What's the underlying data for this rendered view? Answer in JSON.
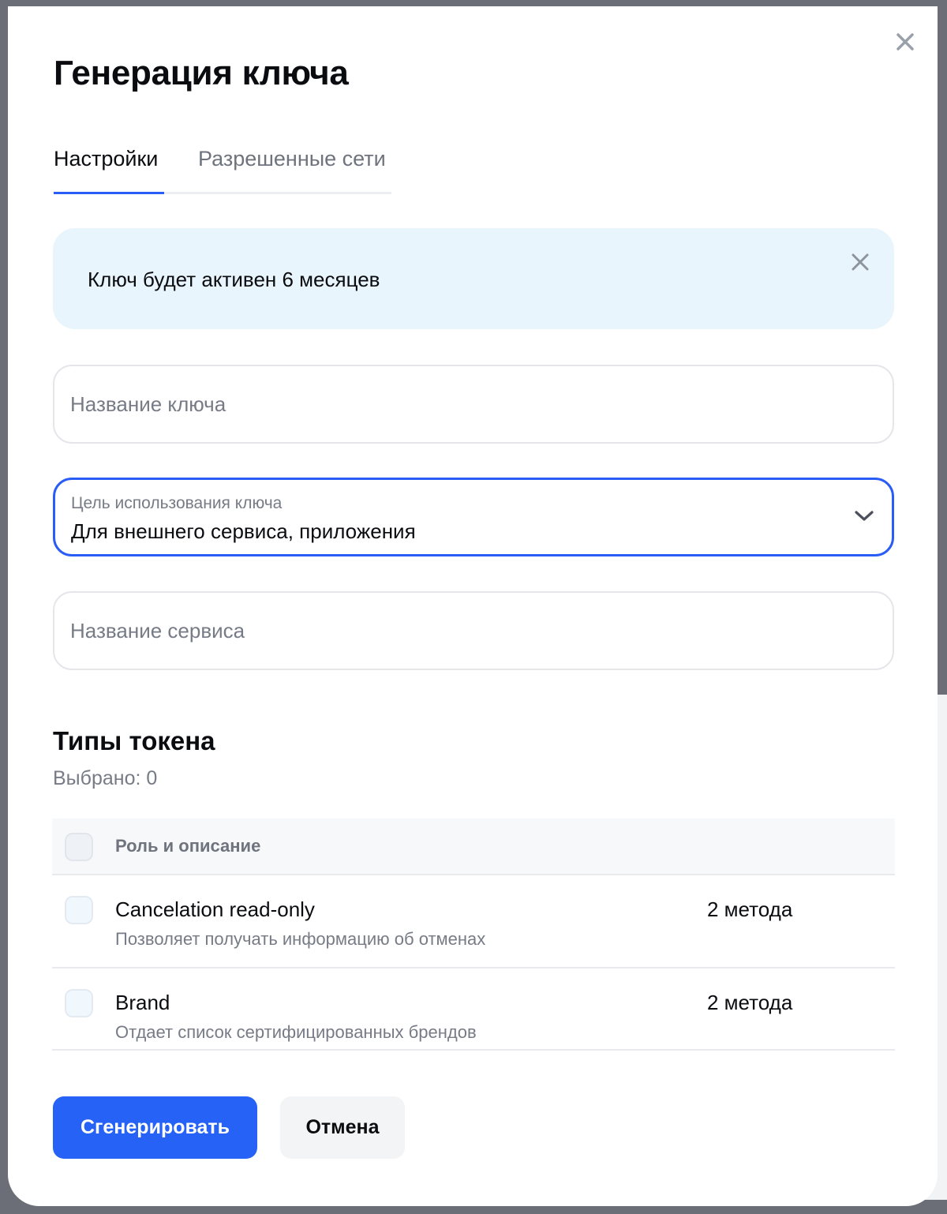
{
  "dialog": {
    "title": "Генерация ключа"
  },
  "tabs": [
    {
      "label": "Настройки",
      "active": true
    },
    {
      "label": "Разрешенные сети",
      "active": false
    }
  ],
  "notice": {
    "text": "Ключ будет активен 6 месяцев"
  },
  "form": {
    "key_name": {
      "value": "",
      "placeholder": "Название ключа"
    },
    "purpose": {
      "label": "Цель использования ключа",
      "value": "Для внешнего сервиса, приложения"
    },
    "service_name": {
      "value": "",
      "placeholder": "Название сервиса"
    }
  },
  "token_types": {
    "title": "Типы токена",
    "selected_text": "Выбрано: 0",
    "header": "Роль и описание",
    "rows": [
      {
        "name": "Cancelation read-only",
        "description": "Позволяет получать информацию об отменах",
        "methods": "2 метода",
        "checked": false
      },
      {
        "name": "Brand",
        "description": "Отдает список сертифицированных брендов",
        "methods": "2 метода",
        "checked": false
      }
    ]
  },
  "actions": {
    "generate_label": "Сгенерировать",
    "cancel_label": "Отмена"
  },
  "colors": {
    "accent": "#2662f6",
    "notice_bg": "#e9f5fc",
    "muted_text": "#767b86"
  },
  "icons": {
    "close": "close-icon",
    "notice_close": "close-icon",
    "dropdown": "chevron-down-icon"
  }
}
